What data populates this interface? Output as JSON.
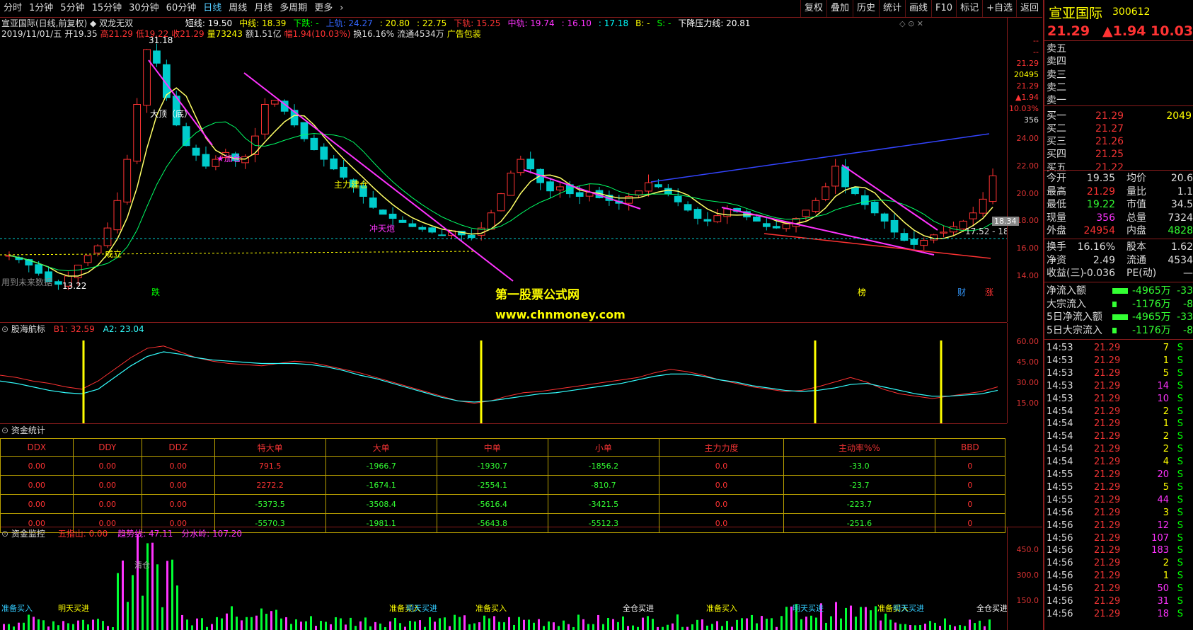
{
  "toolbar": {
    "periods": [
      "分时",
      "1分钟",
      "5分钟",
      "15分钟",
      "30分钟",
      "60分钟",
      "日线",
      "周线",
      "月线",
      "多周期",
      "更多"
    ],
    "active": "日线",
    "tools": [
      "复权",
      "叠加",
      "历史",
      "统计",
      "画线",
      "F10",
      "标记",
      "+自选",
      "返回"
    ]
  },
  "main": {
    "title_stock": "宣亚国际(日线,前复权)",
    "title_indicator": "双龙无双",
    "legend": [
      {
        "label": "短线: 19.50",
        "color": "#ffffff"
      },
      {
        "label": "中线: 18.39",
        "color": "#ffff00"
      },
      {
        "label": "下跌: -",
        "color": "#00ff00"
      },
      {
        "label": "上轨: 24.27",
        "color": "#3366ff"
      },
      {
        "label": ": 20.80",
        "color": "#ffff00"
      },
      {
        "label": ": 22.75",
        "color": "#ffff00"
      },
      {
        "label": "下轨: 15.25",
        "color": "#ff3333"
      },
      {
        "label": "中轨: 19.74",
        "color": "#ff33ff"
      },
      {
        "label": ": 16.10",
        "color": "#ff33ff"
      },
      {
        "label": ": 17.18",
        "color": "#00ffff"
      },
      {
        "label": "B: -",
        "color": "#ffff00"
      },
      {
        "label": "S: -",
        "color": "#00ff00"
      },
      {
        "label": "下降压力线: 20.81",
        "color": "#ffffff"
      }
    ],
    "quote_line": [
      {
        "label": "2019/11/01/五",
        "color": "#dddddd"
      },
      {
        "label": "开19.35",
        "color": "#dddddd"
      },
      {
        "label": "高21.29",
        "color": "#ff3333"
      },
      {
        "label": "低19.22",
        "color": "#ff3333"
      },
      {
        "label": "收21.29",
        "color": "#ff3333"
      },
      {
        "label": "量73243",
        "color": "#ffff00"
      },
      {
        "label": "额1.51亿",
        "color": "#dddddd"
      },
      {
        "label": "幅1.94(10.03%)",
        "color": "#ff3333"
      },
      {
        "label": "换16.16%",
        "color": "#dddddd"
      },
      {
        "label": "流通4534万",
        "color": "#dddddd"
      },
      {
        "label": "广告包装",
        "color": "#ffff00"
      }
    ],
    "annotations": [
      {
        "text": "31.18",
        "color": "#ffffff"
      },
      {
        "text": "大顶（底）",
        "color": "#ffffff"
      },
      {
        "text": "★加仓",
        "color": "#ff33ff"
      },
      {
        "text": "主力建仓",
        "color": "#ffff00"
      },
      {
        "text": "冲天炮",
        "color": "#ff33ff"
      },
      {
        "text": "成立",
        "color": "#ffff00"
      },
      {
        "text": "13.22",
        "color": "#ffffff"
      },
      {
        "text": "用到未来数据",
        "color": "#888888"
      },
      {
        "text": "跌",
        "color": "#00ff00"
      },
      {
        "text": "榜",
        "color": "#ffff00"
      },
      {
        "text": "财",
        "color": "#3399ff"
      },
      {
        "text": "涨",
        "color": "#ff3333"
      },
      {
        "text": "17.52 - 18.",
        "color": "#dddddd"
      }
    ],
    "axis_ticks": [
      "24.00",
      "22.00",
      "20.00",
      "18.00",
      "16.00",
      "14.00"
    ],
    "last_price_tag": "18.34",
    "quote_box": [
      "--",
      "--",
      "21.29",
      "20495",
      "21.29",
      "▲1.94",
      "10.03%",
      "356"
    ]
  },
  "watermark": {
    "line1": "第一股票公式网",
    "line2": "www.chnmoney.com"
  },
  "ind1": {
    "title": "股海航标",
    "b1": "B1: 32.59",
    "a2": "A2: 23.04",
    "axis_ticks": [
      "60.00",
      "45.00",
      "30.00",
      "15.00"
    ]
  },
  "fund": {
    "title": "资金统计",
    "headers": [
      "DDX",
      "DDY",
      "DDZ",
      "特大单",
      "大单",
      "中单",
      "小单",
      "主力力度",
      "主动率%%",
      "BBD"
    ],
    "rows": [
      [
        "0.00",
        "0.00",
        "0.00",
        "791.5",
        "-1966.7",
        "-1930.7",
        "-1856.2",
        "0.0",
        "-33.0",
        "0"
      ],
      [
        "0.00",
        "0.00",
        "0.00",
        "2272.2",
        "-1674.1",
        "-2554.1",
        "-810.7",
        "0.0",
        "-23.7",
        "0"
      ],
      [
        "0.00",
        "0.00",
        "0.00",
        "-5373.5",
        "-3508.4",
        "-5616.4",
        "-3421.5",
        "0.0",
        "-223.7",
        "0"
      ],
      [
        "0.00",
        "0.00",
        "0.00",
        "-5570.3",
        "-1981.1",
        "-5643.8",
        "-5512.3",
        "0.0",
        "-251.6",
        "0"
      ]
    ]
  },
  "ind2": {
    "title": "资金监控",
    "l1": "五指山: 0.00",
    "l2": "趋势线: 47.11",
    "l3": "分水岭: 107.20",
    "axis_ticks": [
      "450.0",
      "300.0",
      "150.0"
    ],
    "labels": [
      "准备买入",
      "明天买进",
      "清仓",
      "准备买入",
      "明天买进",
      "准备买入",
      "全仓买进",
      "准备买入",
      "明天买进",
      "准备买入",
      "明天买进",
      "全仓买进"
    ]
  },
  "side": {
    "name": "宣亚国际",
    "code": "300612",
    "price": "21.29",
    "change": "▲1.94",
    "pct": "10.03%",
    "asks": [
      {
        "l": "卖五",
        "p": "",
        "v": ""
      },
      {
        "l": "卖四",
        "p": "",
        "v": ""
      },
      {
        "l": "卖三",
        "p": "",
        "v": ""
      },
      {
        "l": "卖二",
        "p": "",
        "v": ""
      },
      {
        "l": "卖一",
        "p": "",
        "v": ""
      }
    ],
    "bids": [
      {
        "l": "买一",
        "p": "21.29",
        "v": "2049"
      },
      {
        "l": "买二",
        "p": "21.27",
        "v": ""
      },
      {
        "l": "买三",
        "p": "21.26",
        "v": ""
      },
      {
        "l": "买四",
        "p": "21.25",
        "v": ""
      },
      {
        "l": "买五",
        "p": "21.22",
        "v": ""
      }
    ],
    "stats": [
      {
        "l": "今开",
        "v": "19.35",
        "l2": "均价",
        "v2": "20.6"
      },
      {
        "l": "最高",
        "v": "21.29",
        "l2": "量比",
        "v2": "1.1"
      },
      {
        "l": "最低",
        "v": "19.22",
        "l2": "市值",
        "v2": "34.5"
      },
      {
        "l": "现量",
        "v": "356",
        "l2": "总量",
        "v2": "7324"
      },
      {
        "l": "外盘",
        "v": "24954",
        "l2": "内盘",
        "v2": "4828"
      }
    ],
    "stats2": [
      {
        "l": "换手",
        "v": "16.16%",
        "l2": "股本",
        "v2": "1.62"
      },
      {
        "l": "净资",
        "v": "2.49",
        "l2": "流通",
        "v2": "4534"
      },
      {
        "l": "收益(三)",
        "v": "-0.036",
        "l2": "PE(动)",
        "v2": "—"
      }
    ],
    "flows": [
      {
        "l": "净流入额",
        "v": "-4965万",
        "v2": "-33"
      },
      {
        "l": "大宗流入",
        "v": "-1176万",
        "v2": "-8"
      },
      {
        "l": "5日净流入额",
        "v": "-4965万",
        "v2": "-33"
      },
      {
        "l": "5日大宗流入",
        "v": "-1176万",
        "v2": "-8"
      }
    ],
    "ticks": [
      {
        "t": "14:53",
        "p": "21.29",
        "v": "7",
        "c": "#ffff00"
      },
      {
        "t": "14:53",
        "p": "21.29",
        "v": "1",
        "c": "#ffff00"
      },
      {
        "t": "14:53",
        "p": "21.29",
        "v": "5",
        "c": "#ffff00"
      },
      {
        "t": "14:53",
        "p": "21.29",
        "v": "14",
        "c": "#ff33ff"
      },
      {
        "t": "14:53",
        "p": "21.29",
        "v": "10",
        "c": "#ff33ff"
      },
      {
        "t": "14:54",
        "p": "21.29",
        "v": "2",
        "c": "#ffff00"
      },
      {
        "t": "14:54",
        "p": "21.29",
        "v": "1",
        "c": "#ffff00"
      },
      {
        "t": "14:54",
        "p": "21.29",
        "v": "2",
        "c": "#ffff00"
      },
      {
        "t": "14:54",
        "p": "21.29",
        "v": "2",
        "c": "#ffff00"
      },
      {
        "t": "14:54",
        "p": "21.29",
        "v": "4",
        "c": "#ffff00"
      },
      {
        "t": "14:55",
        "p": "21.29",
        "v": "20",
        "c": "#ff33ff"
      },
      {
        "t": "14:55",
        "p": "21.29",
        "v": "5",
        "c": "#ffff00"
      },
      {
        "t": "14:55",
        "p": "21.29",
        "v": "44",
        "c": "#ff33ff"
      },
      {
        "t": "14:56",
        "p": "21.29",
        "v": "3",
        "c": "#ffff00"
      },
      {
        "t": "14:56",
        "p": "21.29",
        "v": "12",
        "c": "#ff33ff"
      },
      {
        "t": "14:56",
        "p": "21.29",
        "v": "107",
        "c": "#ff33ff"
      },
      {
        "t": "14:56",
        "p": "21.29",
        "v": "183",
        "c": "#ff33ff"
      },
      {
        "t": "14:56",
        "p": "21.29",
        "v": "2",
        "c": "#ffff00"
      },
      {
        "t": "14:56",
        "p": "21.29",
        "v": "1",
        "c": "#ffff00"
      },
      {
        "t": "14:56",
        "p": "21.29",
        "v": "50",
        "c": "#ff33ff"
      },
      {
        "t": "14:56",
        "p": "21.29",
        "v": "31",
        "c": "#ff33ff"
      },
      {
        "t": "14:56",
        "p": "21.29",
        "v": "18",
        "c": "#ff33ff"
      }
    ],
    "side_flag": "S"
  }
}
